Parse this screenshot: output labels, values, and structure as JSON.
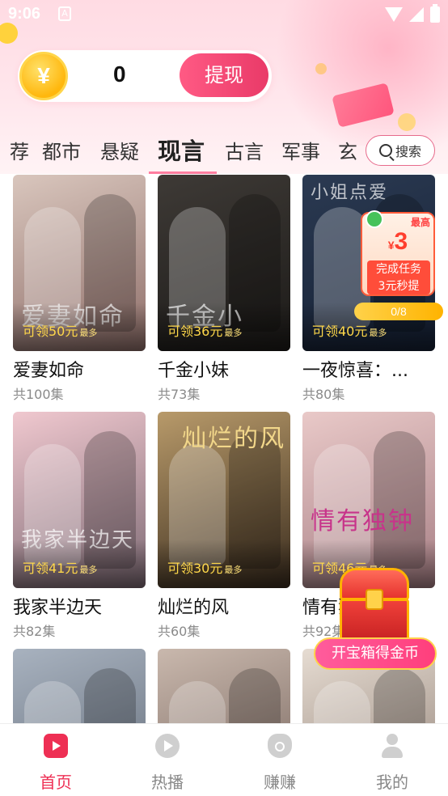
{
  "status_bar": {
    "time": "9:06",
    "notification_glyph": "A"
  },
  "wallet": {
    "currency_symbol": "¥",
    "balance": "0",
    "withdraw_label": "提现"
  },
  "tabs": [
    {
      "label": "荐",
      "active": false
    },
    {
      "label": "都市",
      "active": false
    },
    {
      "label": "悬疑",
      "active": false
    },
    {
      "label": "现言",
      "active": true
    },
    {
      "label": "古言",
      "active": false
    },
    {
      "label": "军事",
      "active": false
    },
    {
      "label": "玄",
      "active": false
    }
  ],
  "search": {
    "label": "搜索",
    "icon": "search-icon"
  },
  "dramas": [
    {
      "title": "爱妻如命",
      "episodes": "共100集",
      "reward": "可领50元",
      "reward_max": "最多",
      "poster_text": "爱妻如命",
      "colors": [
        "#d9c6bd",
        "#8f6f6a"
      ]
    },
    {
      "title": "千金小妹",
      "episodes": "共73集",
      "reward": "可领36元",
      "reward_max": "最多",
      "poster_text": "千金小",
      "colors": [
        "#3e3a36",
        "#1c1a18"
      ]
    },
    {
      "title": "一夜惊喜：...",
      "episodes": "共80集",
      "reward": "可领40元",
      "reward_max": "最多",
      "poster_text": "小姐点爱",
      "colors": [
        "#2b3a52",
        "#152034"
      ]
    },
    {
      "title": "我家半边天",
      "episodes": "共82集",
      "reward": "可领41元",
      "reward_max": "最多",
      "poster_text": "我家半边天",
      "colors": [
        "#f0c8cf",
        "#7d6a74"
      ]
    },
    {
      "title": "灿烂的风",
      "episodes": "共60集",
      "reward": "可领30元",
      "reward_max": "最多",
      "poster_text": "灿烂的风",
      "colors": [
        "#b89a6a",
        "#3a2c1e"
      ]
    },
    {
      "title": "情有独钟",
      "episodes": "共92集",
      "reward": "可领46元",
      "reward_max": "最多",
      "poster_text": "情有独钟",
      "colors": [
        "#e9c9c8",
        "#a77f85"
      ]
    },
    {
      "title": "",
      "episodes": "",
      "reward": "",
      "reward_max": "",
      "poster_text": "",
      "colors": [
        "#a8b2bf",
        "#5d6673"
      ]
    },
    {
      "title": "",
      "episodes": "",
      "reward": "",
      "reward_max": "",
      "poster_text": "",
      "colors": [
        "#c9b8ad",
        "#6e5c55"
      ]
    },
    {
      "title": "",
      "episodes": "",
      "reward": "",
      "reward_max": "",
      "poster_text": "",
      "colors": [
        "#e6dcd2",
        "#8a7a70"
      ]
    }
  ],
  "task_widget": {
    "top_label": "最高",
    "amount": "3",
    "currency": "¥",
    "line1": "完成任务",
    "line2": "3元秒提",
    "progress": "0/8"
  },
  "treasure": {
    "button_label": "开宝箱得金币"
  },
  "bottom_nav": [
    {
      "label": "首页",
      "icon": "home-play-icon",
      "active": true
    },
    {
      "label": "热播",
      "icon": "play-circle-icon",
      "active": false
    },
    {
      "label": "赚赚",
      "icon": "money-bag-icon",
      "active": false
    },
    {
      "label": "我的",
      "icon": "person-icon",
      "active": false
    }
  ],
  "theme": {
    "accent": "#ee2f54",
    "reward_text": "#ffd84a"
  }
}
